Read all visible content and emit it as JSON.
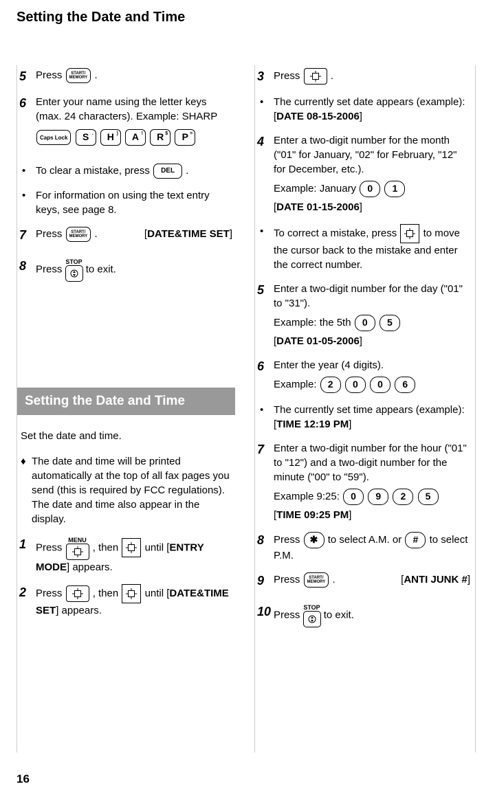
{
  "title": "Setting the Date and Time",
  "page_number": "16",
  "key_labels": {
    "start_memory": "START/\nMEMORY",
    "del": "DEL",
    "caps_lock": "Caps Lock",
    "menu": "MENU",
    "stop": "STOP"
  },
  "left": {
    "step5_press": "Press ",
    "step5_period": ".",
    "step6": "Enter your name using the letter keys (max. 24 characters). Example: SHARP",
    "clear_mistake": "To clear a mistake, press ",
    "clear_period": ".",
    "info_text": "For information on using the text entry keys, see page 8.",
    "step7_press": "Press ",
    "step7_period": ".",
    "step7_label": "DATE&TIME SET",
    "step8_text": " to exit.",
    "step8_press": "Press ",
    "section_title": "Setting the Date and Time",
    "intro": "Set the date and time.",
    "diamond": "The date and time will be printed automatically at the top of all fax pages you send (this is required by FCC regulations). The date and time also appear in the display.",
    "step1_a": "Press ",
    "step1_b": ", then ",
    "step1_c": " until [",
    "step1_label": "ENTRY MODE",
    "step1_d": "] appears.",
    "step2_a": "Press ",
    "step2_b": ", then ",
    "step2_c": " until [",
    "step2_label": "DATE&TIME SET",
    "step2_d": "] appears."
  },
  "right": {
    "step3_press": "Press ",
    "step3_period": ".",
    "bullet1_a": "The currently set date appears (example): [",
    "bullet1_label": "DATE 08-15-2006",
    "bullet1_b": "]",
    "step4_a": "Enter a two-digit number for the month (\"01\" for January, \"02\" for February, \"12\" for December, etc.).",
    "step4_example": "Example: January ",
    "step4_label_open": "[",
    "step4_label": "DATE 01-15-2006",
    "step4_label_close": "]",
    "bullet2_a": "To correct a mistake, press ",
    "bullet2_b": " to move the cursor back to the mistake and enter the correct number.",
    "step5_a": "Enter a two-digit number for the day (\"01\" to \"31\").",
    "step5_example": "Example:  the 5th ",
    "step5_label": "DATE 01-05-2006",
    "step6_a": "Enter the year (4 digits).",
    "step6_example": "Example: ",
    "bullet3_a": "The currently set time appears (example): [",
    "bullet3_label": "TIME 12:19 PM",
    "bullet3_b": "]",
    "step7_a": "Enter a two-digit number for the hour (\"01\" to \"12\") and a two-digit number for the minute (\"00\" to \"59\").",
    "step7_example": "Example 9:25: ",
    "step7_label": "TIME 09:25 PM",
    "step8_a": "Press ",
    "step8_b": " to select A.M. or ",
    "step8_c": " to select P.M.",
    "step9_press": "Press ",
    "step9_period": ".",
    "step9_label": "ANTI JUNK #",
    "step10_press": "Press ",
    "step10_text": " to exit."
  },
  "numbers": {
    "five": "5",
    "six": "6",
    "seven": "7",
    "eight": "8",
    "three": "3",
    "four": "4",
    "one": "1",
    "two": "2",
    "nine": "9",
    "ten": "10",
    "zero": "0"
  },
  "letters": {
    "s": "S",
    "h": "H",
    "a": "A",
    "r": "R",
    "p": "P",
    "star": "✱",
    "hash": "#"
  }
}
